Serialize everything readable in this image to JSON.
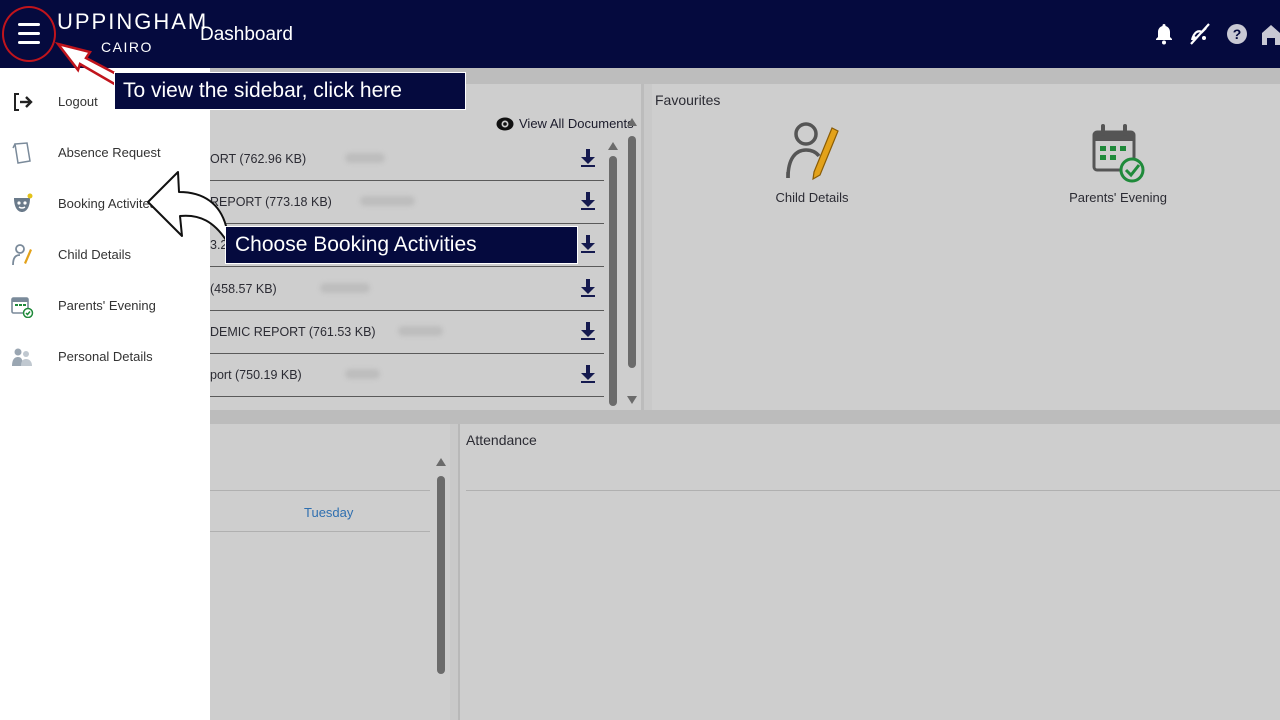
{
  "header": {
    "logo_main": "UPPINGHAM",
    "logo_sub": "CAIRO",
    "title": "Dashboard",
    "icons": [
      "bell-icon",
      "no-bandwidth-icon",
      "help-icon",
      "home-icon"
    ]
  },
  "documents": {
    "view_all_label": "View All Documents",
    "rows": [
      {
        "name": "ORT (762.96 KB)"
      },
      {
        "name": "REPORT (773.18 KB)"
      },
      {
        "name": "3.2"
      },
      {
        "name": "(458.57 KB)"
      },
      {
        "name": "DEMIC REPORT (761.53 KB)"
      },
      {
        "name": "port (750.19 KB)"
      }
    ]
  },
  "favourites": {
    "title": "Favourites",
    "items": [
      {
        "label": "Child Details",
        "icon": "child-details-icon"
      },
      {
        "label": "Parents' Evening",
        "icon": "parents-evening-icon"
      }
    ]
  },
  "calendar": {
    "day_label": "Tuesday"
  },
  "attendance": {
    "title": "Attendance"
  },
  "sidebar": {
    "items": [
      {
        "label": "Logout",
        "icon": "logout-icon"
      },
      {
        "label": "Absence Request",
        "icon": "absence-request-icon"
      },
      {
        "label": "Booking Activites",
        "icon": "booking-activities-icon"
      },
      {
        "label": "Child Details",
        "icon": "child-details-icon"
      },
      {
        "label": "Parents' Evening",
        "icon": "parents-evening-icon"
      },
      {
        "label": "Personal Details",
        "icon": "personal-details-icon"
      }
    ]
  },
  "annotations": {
    "callout_sidebar": "To view the sidebar, click here",
    "callout_booking": "Choose Booking Activities",
    "colors": {
      "ring": "#c0141c",
      "callout_bg": "#050a3e"
    }
  },
  "colors": {
    "topbar": "#050a3e",
    "link_blue": "#2f6fb0",
    "parents_evening_green": "#1f8a3a",
    "pencil_orange": "#e3a21a"
  }
}
